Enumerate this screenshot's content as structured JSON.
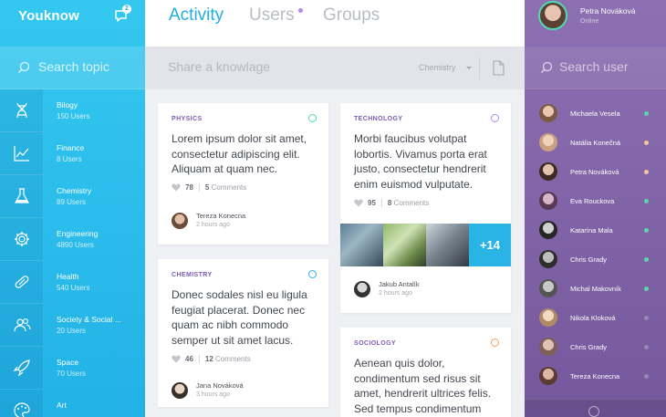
{
  "app": {
    "name": "Youknow",
    "chat_count": "2"
  },
  "left": {
    "search_placeholder": "Search topic",
    "categories": [
      {
        "name": "Bilogy",
        "count": "150 Users",
        "icon": "dna-icon"
      },
      {
        "name": "Finance",
        "count": "8 Users",
        "icon": "chart-line-icon"
      },
      {
        "name": "Chemistry",
        "count": "89 Users",
        "icon": "flask-icon"
      },
      {
        "name": "Engineering",
        "count": "4890 Users",
        "icon": "gear-icon"
      },
      {
        "name": "Health",
        "count": "540 Users",
        "icon": "pill-icon"
      },
      {
        "name": "Society & Social ...",
        "count": "20 Users",
        "icon": "people-icon"
      },
      {
        "name": "Space",
        "count": "70 Users",
        "icon": "rocket-icon"
      },
      {
        "name": "Art",
        "count": "",
        "icon": "palette-icon"
      }
    ]
  },
  "tabs": [
    {
      "label": "Activity",
      "active": true
    },
    {
      "label": "Users",
      "active": false,
      "has_dot": true
    },
    {
      "label": "Groups",
      "active": false
    }
  ],
  "share": {
    "placeholder": "Share a knowlage",
    "topic": "Chemistry"
  },
  "cards": [
    {
      "tag": "PHYSICS",
      "ring_color": "#4fd9b0",
      "text": "Lorem ipsum dolor sit amet, consectetur adipiscing elit. Aliquam at quam nec.",
      "likes": "78",
      "comments_count": "5",
      "comments_label": "Comments",
      "author": "Tereza Konecna",
      "time": "2 hours ago"
    },
    {
      "tag": "TECHNOLOGY",
      "ring_color": "#b18ae6",
      "text": "Morbi faucibus volutpat lobortis. Vivamus porta erat justo, consectetur hendrerit enim euismod vulputate.",
      "likes": "95",
      "comments_count": "8",
      "comments_label": "Comments",
      "photos_more": "+14",
      "author": "Jakub Antalík",
      "time": "2 hours ago"
    },
    {
      "tag": "CHEMISTRY",
      "ring_color": "#2ab4e6",
      "text": "Donec sodales nisl eu ligula feugiat placerat. Donec nec quam ac nibh commodo semper ut sit amet lacus.",
      "likes": "46",
      "comments_count": "12",
      "comments_label": "Comments",
      "author": "Jana Nováková",
      "time": "3 hours ago"
    },
    {
      "tag": "SOCIOLOGY",
      "ring_color": "#f5a05a",
      "text": "Aenean quis dolor, condimentum sed risus sit amet, hendrerit ultrices felis. Sed tempus condimentum fermentum."
    }
  ],
  "right": {
    "me": {
      "name": "Petra Nováková",
      "status": "Online"
    },
    "search_placeholder": "Search user",
    "users": [
      {
        "name": "Michaela Vesela",
        "status_color": "#58d8a8"
      },
      {
        "name": "Natália Konečná",
        "status_color": "#f5c49a"
      },
      {
        "name": "Petra Nováková",
        "status_color": "#f5c49a"
      },
      {
        "name": "Eva Rouckova",
        "status_color": "#58d8a8"
      },
      {
        "name": "Katarína Mala",
        "status_color": "#58d8a8"
      },
      {
        "name": "Chris Grady",
        "status_color": "#58d8a8"
      },
      {
        "name": "Michal Makovník",
        "status_color": "#58d8a8"
      },
      {
        "name": "Nikola Kloková",
        "status_color": "#9b86b8"
      },
      {
        "name": "Chris Grady",
        "status_color": "#9b86b8"
      },
      {
        "name": "Tereza Konecna",
        "status_color": "#9b86b8"
      }
    ]
  }
}
